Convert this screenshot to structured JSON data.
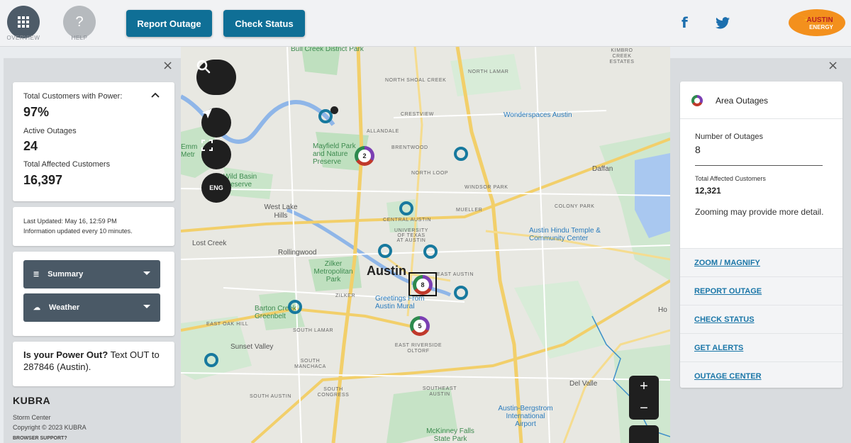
{
  "topbar": {
    "overview_label": "OVERVIEW",
    "help_label": "HELP",
    "help_icon_text": "?",
    "report_outage_btn": "Report Outage",
    "check_status_btn": "Check Status",
    "logo_line1": "AUSTIN",
    "logo_line2": "ENERGY",
    "accent_color": "#0f6f96"
  },
  "summary_card": {
    "customers_with_power_label": "Total Customers with Power:",
    "customers_with_power_value": "97%",
    "active_outages_label": "Active Outages",
    "active_outages_value": "24",
    "affected_customers_label": "Total Affected Customers",
    "affected_customers_value": "16,397"
  },
  "update_card": {
    "last_updated": "Last Updated:  May 16, 12:59 PM",
    "update_freq": "Information updated every 10 minutes."
  },
  "dropdowns": {
    "summary": "Summary",
    "weather": "Weather"
  },
  "text_card": {
    "text": "Is your Power Out? Text OUT to 287846 (Austin).",
    "bold_part": "Is your Power Out?",
    "rest": " Text OUT to 287846 (Austin)."
  },
  "footer": {
    "brand": "KUBRA",
    "storm_center": "Storm Center",
    "copyright": "Copyright © 2023 KUBRA",
    "browser_support": "BROWSER SUPPORT?"
  },
  "map": {
    "language_btn": "ENG",
    "city_label": "Austin",
    "clusters": [
      "2",
      "8",
      "5"
    ],
    "labels": {
      "bull_creek": "Bull Creek District Park",
      "north_shoal_creek": "NORTH SHOAL CREEK",
      "north_lamar": "NORTH LAMAR",
      "crestview": "CRESTVIEW",
      "allandale": "ALLANDALE",
      "wonderspaces": "Wonderspaces Austin",
      "mayfield": "Mayfield Park and Nature Preserve",
      "brentwood": "BRENTWOOD",
      "daffan": "Daffan",
      "north_loop": "NORTH LOOP",
      "windsor_park": "WINDSOR PARK",
      "west_lake_hills": "West Lake Hills",
      "mueller": "MUELLER",
      "colony_park": "COLONY PARK",
      "central_austin": "CENTRAL AUSTIN",
      "university": "UNIVERSITY OF TEXAS AT AUSTIN",
      "hindu_temple": "Austin Hindu Temple & Community Center",
      "lost_creek": "Lost Creek",
      "rollingwood": "Rollingwood",
      "zilker_park": "Zilker Metropolitan Park",
      "east_austin": "EAST AUSTIN",
      "zilker": "ZILKER",
      "greetings_mural": "Greetings From Austin Mural",
      "barton_creek": "Barton Creek Greenbelt",
      "east_oak_hill": "EAST OAK HILL",
      "south_lamar": "SOUTH LAMAR",
      "sunset_valley": "Sunset Valley",
      "east_riverside": "EAST RIVERSIDE OLTORF",
      "south_manchaca": "SOUTH MANCHACA",
      "southeast_austin": "SOUTHEAST AUSTIN",
      "south_austin": "SOUTH AUSTIN",
      "south_congress": "SOUTH CONGRESS",
      "del_valle": "Del Valle",
      "airport": "Austin-Bergstrom International Airport",
      "mckinney": "McKinney Falls State Park",
      "emma": "Emm Metr",
      "wild_basin": "Wild Basin Preserve",
      "kimbro": "KIMBRO CREEK ESTATES",
      "ho": "Ho"
    }
  },
  "area_outages": {
    "title": "Area Outages",
    "num_outages_label": "Number of Outages",
    "num_outages_value": "8",
    "affected_label": "Total Affected Customers",
    "affected_value": "12,321",
    "zoom_hint": "Zooming may provide more detail.",
    "links": [
      "ZOOM / MAGNIFY",
      "REPORT OUTAGE",
      "CHECK STATUS",
      "GET ALERTS",
      "OUTAGE CENTER"
    ]
  }
}
